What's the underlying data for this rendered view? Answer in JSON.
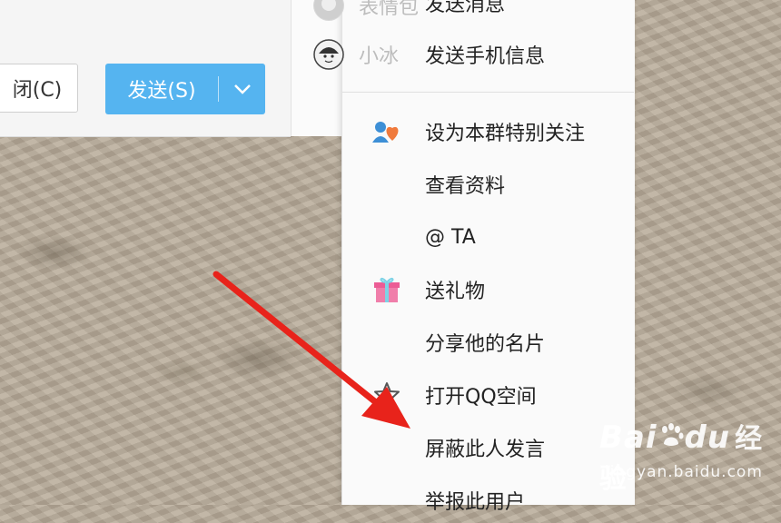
{
  "chat": {
    "close_label": "闭(C)",
    "send_label": "发送(S)",
    "send_dropdown_icon": "chevron-down-icon"
  },
  "context_menu": {
    "top_rows": [
      {
        "name": "表情包",
        "action": "发送消息"
      },
      {
        "name": "小冰",
        "action": "发送手机信息"
      }
    ],
    "items": [
      {
        "label": "设为本群特别关注",
        "icon": "special-follow-icon"
      },
      {
        "label": "查看资料",
        "icon": ""
      },
      {
        "label": "@ TA",
        "icon": ""
      },
      {
        "label": "送礼物",
        "icon": "gift-icon"
      },
      {
        "label": "分享他的名片",
        "icon": ""
      },
      {
        "label": "打开QQ空间",
        "icon": "star-icon"
      },
      {
        "label": "屏蔽此人发言",
        "icon": ""
      },
      {
        "label": "举报此用户",
        "icon": ""
      }
    ]
  },
  "annotation": {
    "color": "#e8231b",
    "type": "red-arrow"
  },
  "watermark": {
    "logo": "Bai",
    "logo2": "du",
    "cn": "经验",
    "url": "jingyan.baidu.com"
  },
  "colors": {
    "send_button": "#55b4f0",
    "arrow": "#e8231b"
  }
}
